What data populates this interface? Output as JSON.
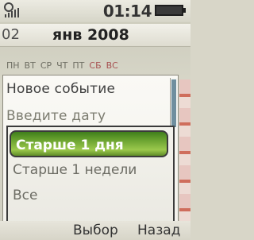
{
  "status_bar": {
    "time": "01:14",
    "signal_icon": "signal-bars-icon",
    "battery_icon": "battery-icon"
  },
  "calendar": {
    "year_prefix": "02",
    "month_title": "янв 2008",
    "weekdays": [
      "ПН",
      "ВТ",
      "СР",
      "ЧТ",
      "ПТ",
      "СБ",
      "ВС"
    ]
  },
  "menu": {
    "items": [
      "Новое событие",
      "Введите дату"
    ],
    "submenu": {
      "items": [
        "Старше 1 дня",
        "Старше 1 недели",
        "Все"
      ],
      "selected": "Старше 1 дня"
    }
  },
  "softkeys": {
    "left": "Выбор",
    "right": "Назад"
  },
  "colors": {
    "selection": "#6fa833",
    "menu_text": "#6c6c64"
  }
}
